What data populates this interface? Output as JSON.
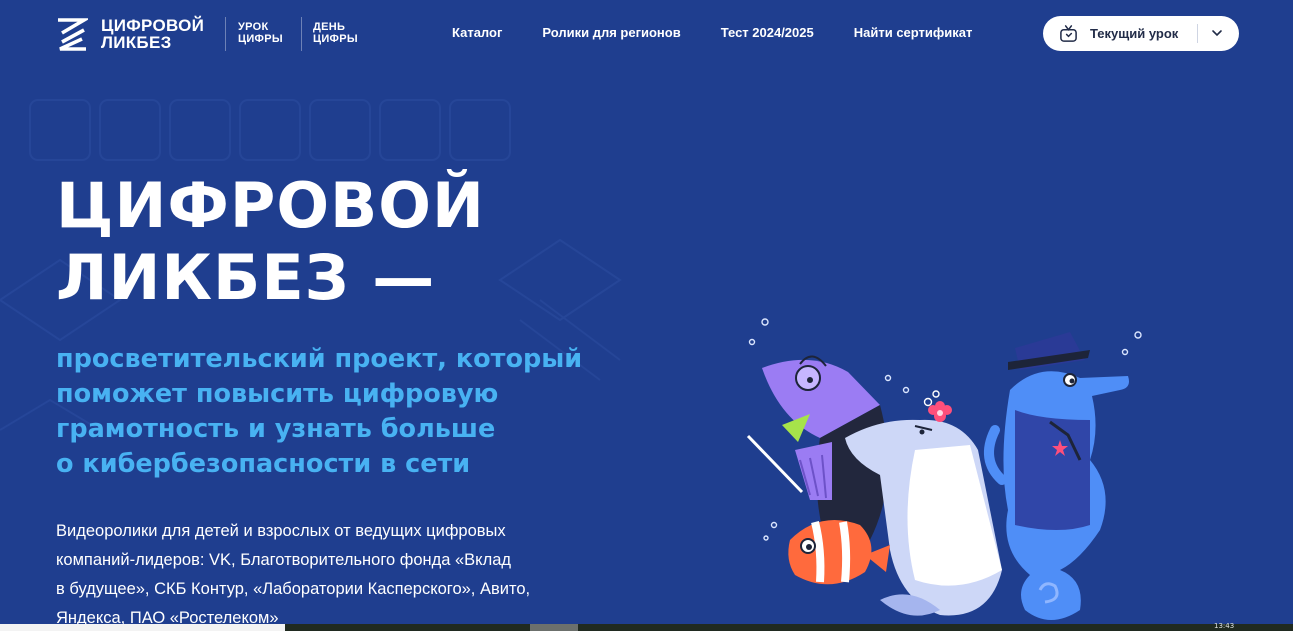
{
  "colors": {
    "background": "#1f3e8f",
    "accent_blue": "#48b2f2",
    "text": "#ffffff",
    "button_bg": "#ffffff"
  },
  "header": {
    "logo": {
      "line1": "ЦИФРОВОЙ",
      "line2": "ЛИКБЕЗ",
      "icon": "logo-chevrons-icon"
    },
    "urok": {
      "line1": "УРОК",
      "line2": "ЦИФРЫ"
    },
    "den": {
      "line1": "ДЕНЬ",
      "line2": "ЦИФРЫ"
    },
    "nav": [
      {
        "label": "Каталог"
      },
      {
        "label": "Ролики для регионов"
      },
      {
        "label": "Тест 2024/2025"
      },
      {
        "label": "Найти сертификат"
      }
    ],
    "lesson_button": {
      "label": "Текущий урок",
      "icon": "tv-icon",
      "chevron": "chevron-down-icon"
    }
  },
  "hero": {
    "title_line1": "ЦИФРОВОЙ",
    "title_line2": "ЛИКБЕЗ —",
    "subtitle_lines": [
      "просветительский проект, который",
      "поможет повысить цифровую",
      "грамотность и узнать больше",
      "о кибербезопасности в сети"
    ],
    "body_lines": [
      "Видеоролики для детей и взрослых от ведущих цифровых",
      "компаний-лидеров: VK, Благотворительного фонда «Вклад",
      "в будущее», СКБ Контур, «Лаборатории Касперского», Авито,",
      "Яндекса, ПАО «Ростелеком»"
    ]
  },
  "os": {
    "clock": "13:43"
  }
}
